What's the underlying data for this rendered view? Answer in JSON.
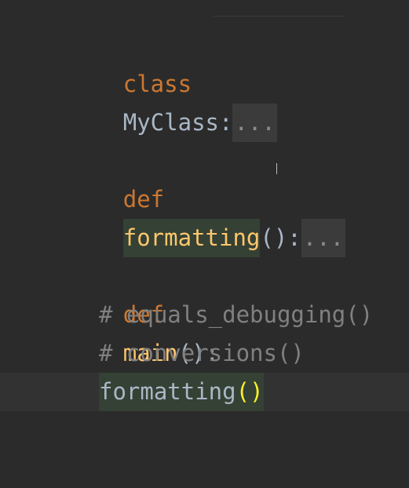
{
  "editor": {
    "lines": [
      {
        "keyword": "class",
        "name": "MyClass",
        "colon": ":",
        "fold": "..."
      },
      {
        "keyword": "def",
        "name": "formatting",
        "parens": "()",
        "colon": ":",
        "fold": "..."
      },
      {
        "keyword": "def",
        "name": "main",
        "parens": "():"
      },
      {
        "comment": "# equals_debugging()"
      },
      {
        "comment": "# conversions()"
      },
      {
        "call": "formatting",
        "parens": "()"
      }
    ]
  },
  "colors": {
    "background": "#2b2b2b",
    "keyword": "#cc7832",
    "function": "#ffc66d",
    "default_text": "#a9b7c6",
    "comment": "#808080",
    "usage_highlight": "#344134",
    "folded_region": "#3b3b3b",
    "matched_brace": "#ffef28"
  }
}
